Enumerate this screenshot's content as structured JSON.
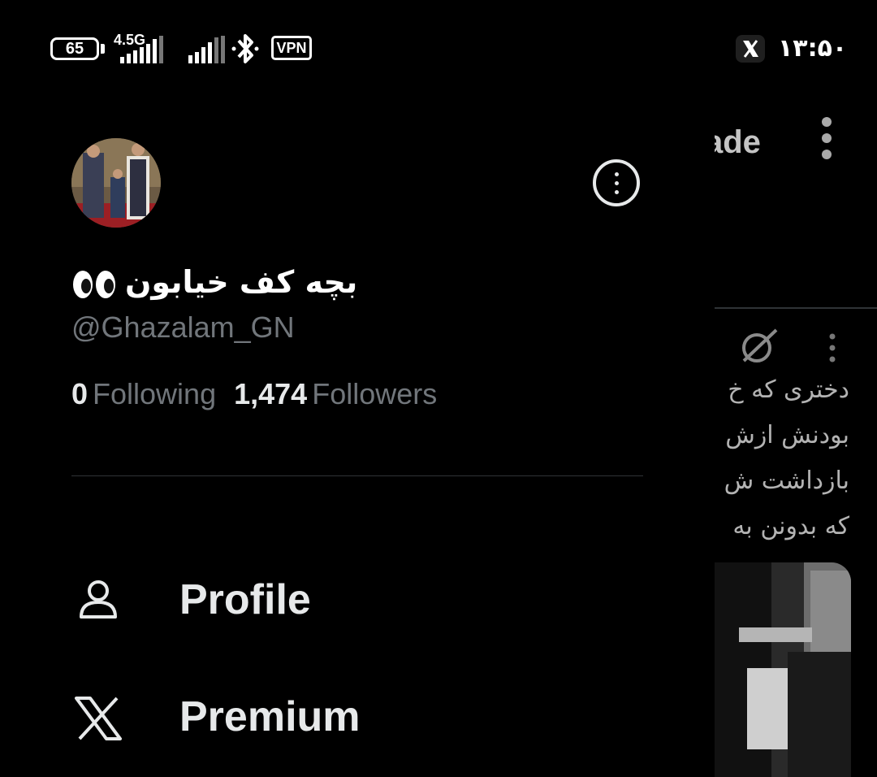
{
  "status_bar": {
    "battery": "65",
    "network": "4.5G",
    "vpn": "VPN",
    "time": "۱۳:۵۰",
    "icons": [
      "battery-icon",
      "signal-icon",
      "bluetooth-icon",
      "vpn-icon",
      "x-app-icon"
    ]
  },
  "background_feed": {
    "partial_title": "ade",
    "post_lines": [
      "دختری که خ",
      "بودنش ازش",
      "بازداشت ش",
      "که بدونن به"
    ]
  },
  "drawer": {
    "display_name": "بچه کف خیابون",
    "handle": "@Ghazalam_GN",
    "following_count": "0",
    "following_label": "Following",
    "followers_count": "1,474",
    "followers_label": "Followers",
    "menu": [
      {
        "label": "Profile",
        "icon": "person-icon"
      },
      {
        "label": "Premium",
        "icon": "x-logo-icon"
      }
    ]
  },
  "colors": {
    "background": "#000000",
    "primary_text": "#e7e9ea",
    "secondary_text": "#71767b",
    "divider": "#2f3336"
  }
}
